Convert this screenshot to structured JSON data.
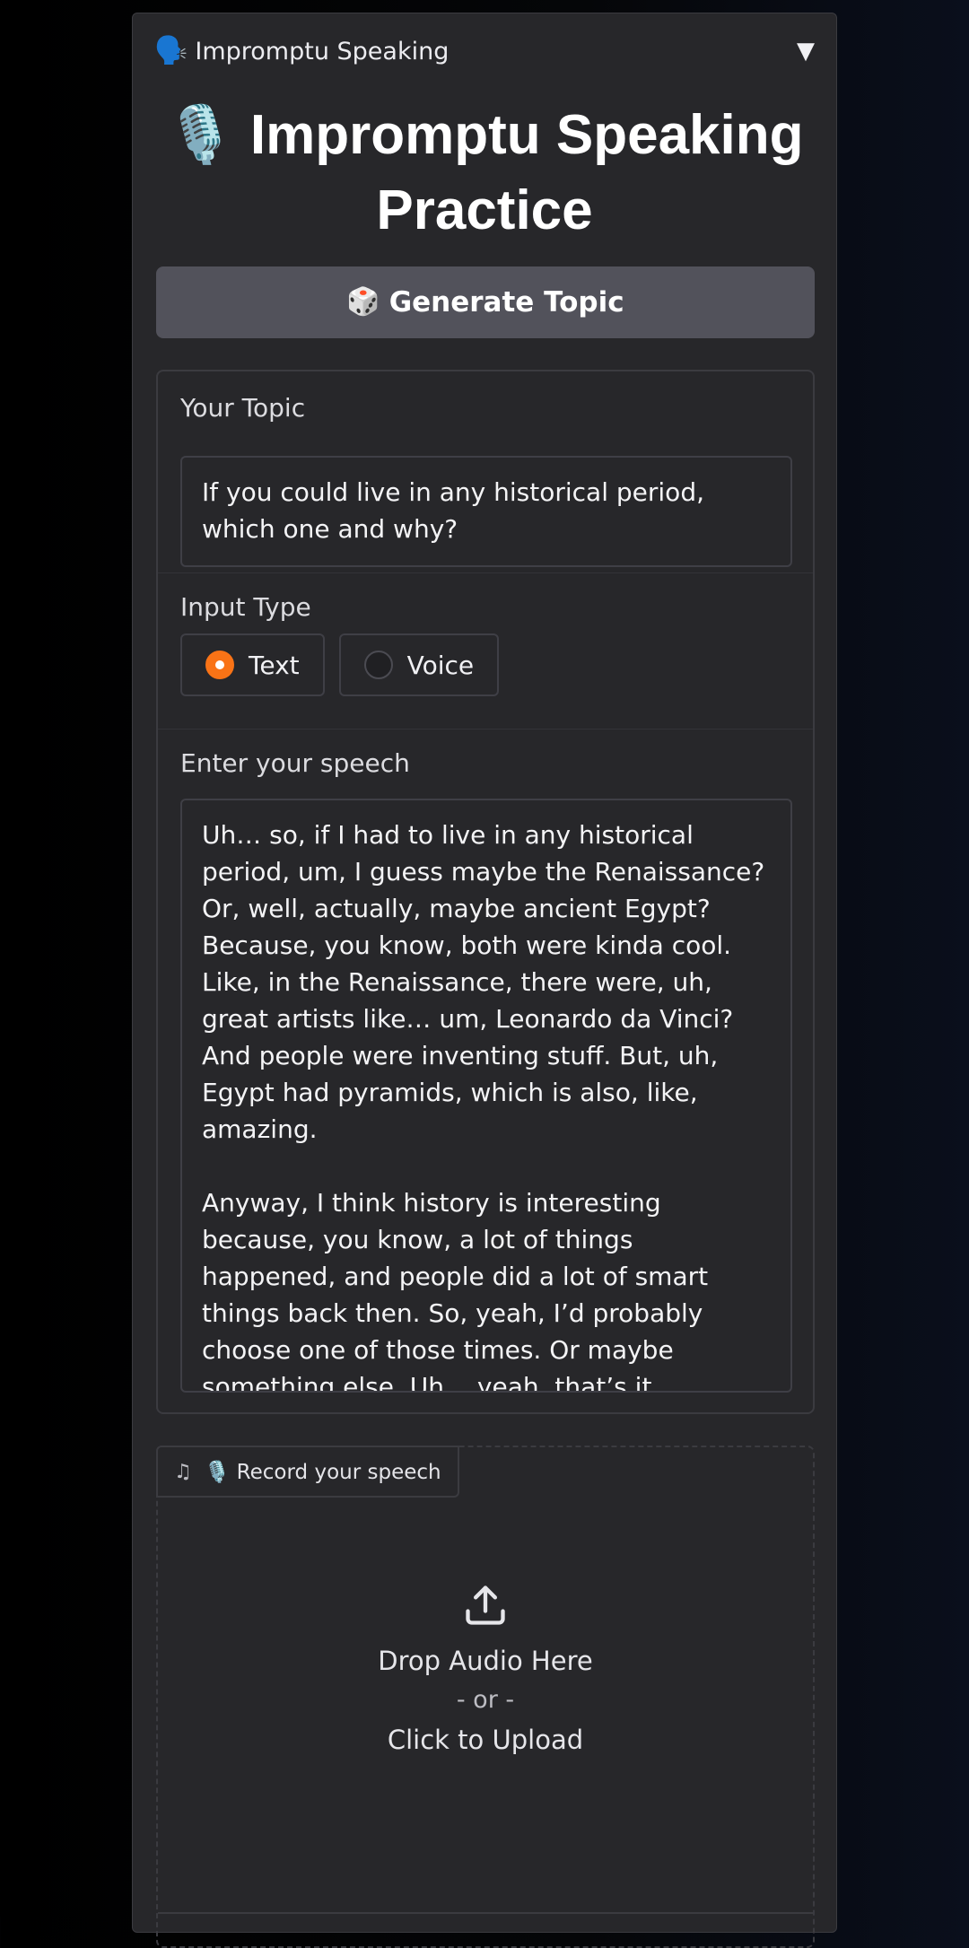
{
  "accordion": {
    "icon": "🗣️",
    "title": "Impromptu Speaking",
    "caret": "▼"
  },
  "page_title": "🎙️ Impromptu Speaking Practice",
  "generate_button": {
    "icon": "🎲",
    "label": "Generate Topic"
  },
  "topic": {
    "label": "Your Topic",
    "value": "If you could live in any historical period, which one and why?"
  },
  "input_type": {
    "label": "Input Type",
    "options": [
      "Text",
      "Voice"
    ],
    "selected": "Text"
  },
  "speech": {
    "label": "Enter your speech",
    "value": "Uh… so, if I had to live in any historical period, um, I guess maybe the Renaissance? Or, well, actually, maybe ancient Egypt? Because, you know, both were kinda cool. Like, in the Renaissance, there were, uh, great artists like… um, Leonardo da Vinci? And people were inventing stuff. But, uh, Egypt had pyramids, which is also, like, amazing.\n\nAnyway, I think history is interesting because, you know, a lot of things happened, and people did a lot of smart things back then. So, yeah, I’d probably choose one of those times. Or maybe something else. Uh… yeah, that’s it."
  },
  "audio": {
    "note_icon": "♫",
    "label": "🎙️ Record your speech",
    "drop_text": "Drop Audio Here",
    "or_text": "- or -",
    "click_text": "Click to Upload"
  },
  "colors": {
    "accent": "#f97316",
    "panel_bg": "#27272a",
    "button_bg": "#52525b"
  }
}
